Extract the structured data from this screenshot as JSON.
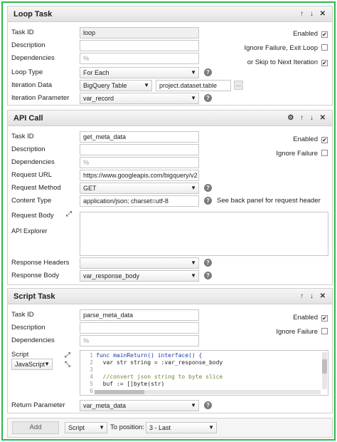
{
  "loop": {
    "title": "Loop Task",
    "controls": "↑ ↓ ✕",
    "task_id_label": "Task ID",
    "task_id": "loop",
    "description_label": "Description",
    "dependencies_label": "Dependencies",
    "loop_type_label": "Loop Type",
    "loop_type": "For Each",
    "iteration_data_label": "Iteration Data",
    "iteration_source": "BigQuery Table",
    "iteration_table": "project.dataset.table",
    "iteration_param_label": "Iteration Parameter",
    "iteration_param": "var_record",
    "enabled_label": "Enabled",
    "ignore_failure_exit_label": "Ignore Failure, Exit Loop",
    "skip_next_label": "or Skip to Next Iteration",
    "ellipsis": "..."
  },
  "api": {
    "title": "API Call",
    "controls": "⚙ ↑ ↓ ✕",
    "task_id_label": "Task ID",
    "task_id": "get_meta_data",
    "description_label": "Description",
    "dependencies_label": "Dependencies",
    "request_url_label": "Request URL",
    "request_url": "https://www.googleapis.com/bigquery/v2",
    "request_method_label": "Request Method",
    "request_method": "GET",
    "content_type_label": "Content Type",
    "content_type": "application/json; charset=utf-8",
    "content_type_note": "See back panel for request header",
    "request_body_label": "Request Body",
    "api_explorer_label": "API Explorer",
    "response_headers_label": "Response Headers",
    "response_body_label": "Response Body",
    "response_body": "var_response_body",
    "enabled_label": "Enabled",
    "ignore_failure_label": "Ignore Failure"
  },
  "script": {
    "title": "Script Task",
    "controls": "↑ ↓ ✕",
    "task_id_label": "Task ID",
    "task_id": "parse_meta_data",
    "description_label": "Description",
    "dependencies_label": "Dependencies",
    "script_label": "Script",
    "language": "JavaScript",
    "code_lines": [
      {
        "n": "1",
        "t": "func mainReturn() interface() {"
      },
      {
        "n": "2",
        "t": "  var str string = :var_response_body"
      },
      {
        "n": "3",
        "t": ""
      },
      {
        "n": "4",
        "t": "  //convert json string to byte slice"
      },
      {
        "n": "5",
        "t": "  buf := []byte(str)"
      },
      {
        "n": "6",
        "t": ""
      }
    ],
    "return_param_label": "Return Parameter",
    "return_param": "var_meta_data",
    "enabled_label": "Enabled",
    "ignore_failure_label": "Ignore Failure"
  },
  "footer": {
    "add_label": "Add",
    "task_type": "Script",
    "to_position_label": "To position:",
    "position": "3 - Last"
  },
  "colors": {
    "frame": "#2db84a"
  },
  "icons": [
    "link-icon",
    "help-icon",
    "expand-icon",
    "collapse-icon",
    "gear-icon",
    "arrow-up-icon",
    "arrow-down-icon",
    "close-icon",
    "check-icon"
  ]
}
